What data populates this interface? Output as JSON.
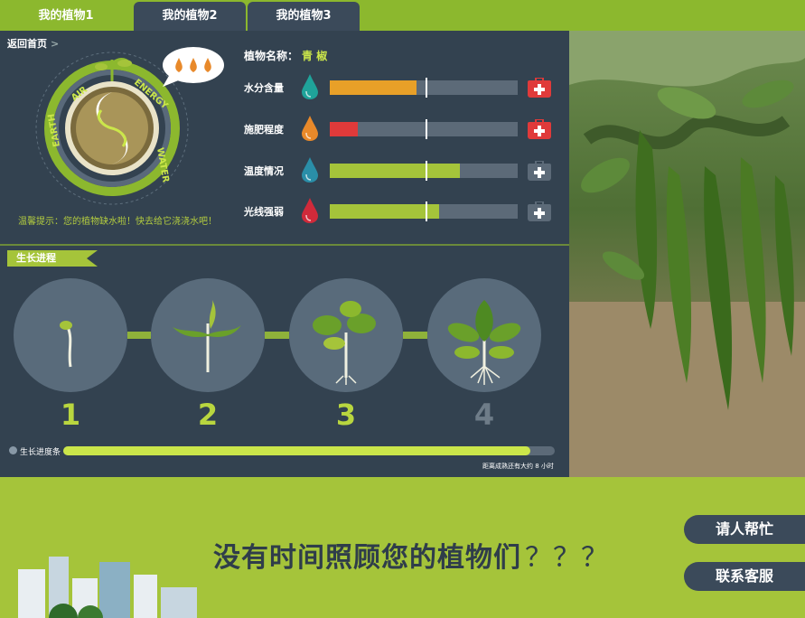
{
  "tabs": [
    {
      "label": "我的植物1",
      "active": true
    },
    {
      "label": "我的植物2",
      "active": false
    },
    {
      "label": "我的植物3",
      "active": false
    }
  ],
  "nav": {
    "back_label": "返回首页",
    "back_arrow": ">"
  },
  "emblem": {
    "ring_words": [
      "AIR",
      "ENERGY",
      "WATER",
      "EARTH"
    ]
  },
  "tip": "温馨提示：您的植物缺水啦！快去给它浇浇水吧！",
  "plant": {
    "name_label": "植物名称：",
    "name_value": "青 椒"
  },
  "metrics": [
    {
      "label": "水分含量",
      "value_fraction": 0.46,
      "color": "#e8a028",
      "drop_color": "#1fa39a",
      "kit_color": "#e03a3a",
      "alert": true
    },
    {
      "label": "施肥程度",
      "value_fraction": 0.15,
      "color": "#e03a3a",
      "drop_color": "#e8892a",
      "kit_color": "#e03a3a",
      "alert": true
    },
    {
      "label": "温度情况",
      "value_fraction": 0.69,
      "color": "#a5c43a",
      "drop_color": "#2a8ea8",
      "kit_color": "#5c6a78",
      "alert": false
    },
    {
      "label": "光线强弱",
      "value_fraction": 0.58,
      "color": "#a5c43a",
      "drop_color": "#d02a3a",
      "kit_color": "#5c6a78",
      "alert": false
    }
  ],
  "growth": {
    "title": "生长进程",
    "stages": [
      {
        "number": "1",
        "icon": "sprout-icon"
      },
      {
        "number": "2",
        "icon": "seedling-icon"
      },
      {
        "number": "3",
        "icon": "young-plant-icon"
      },
      {
        "number": "4",
        "icon": "mature-plant-icon"
      }
    ],
    "progress_label": "生长进度条",
    "progress_fraction": 0.95,
    "progress_note": "距离成熟还有大约 8 小时"
  },
  "promo": {
    "headline": "没有时间照顾您的植物们",
    "headline_suffix": "？？？",
    "buttons": [
      "请人帮忙",
      "联系客服"
    ]
  },
  "colors": {
    "accent": "#a5c43a",
    "panel": "#334250",
    "stage_circle": "#596b7b"
  }
}
